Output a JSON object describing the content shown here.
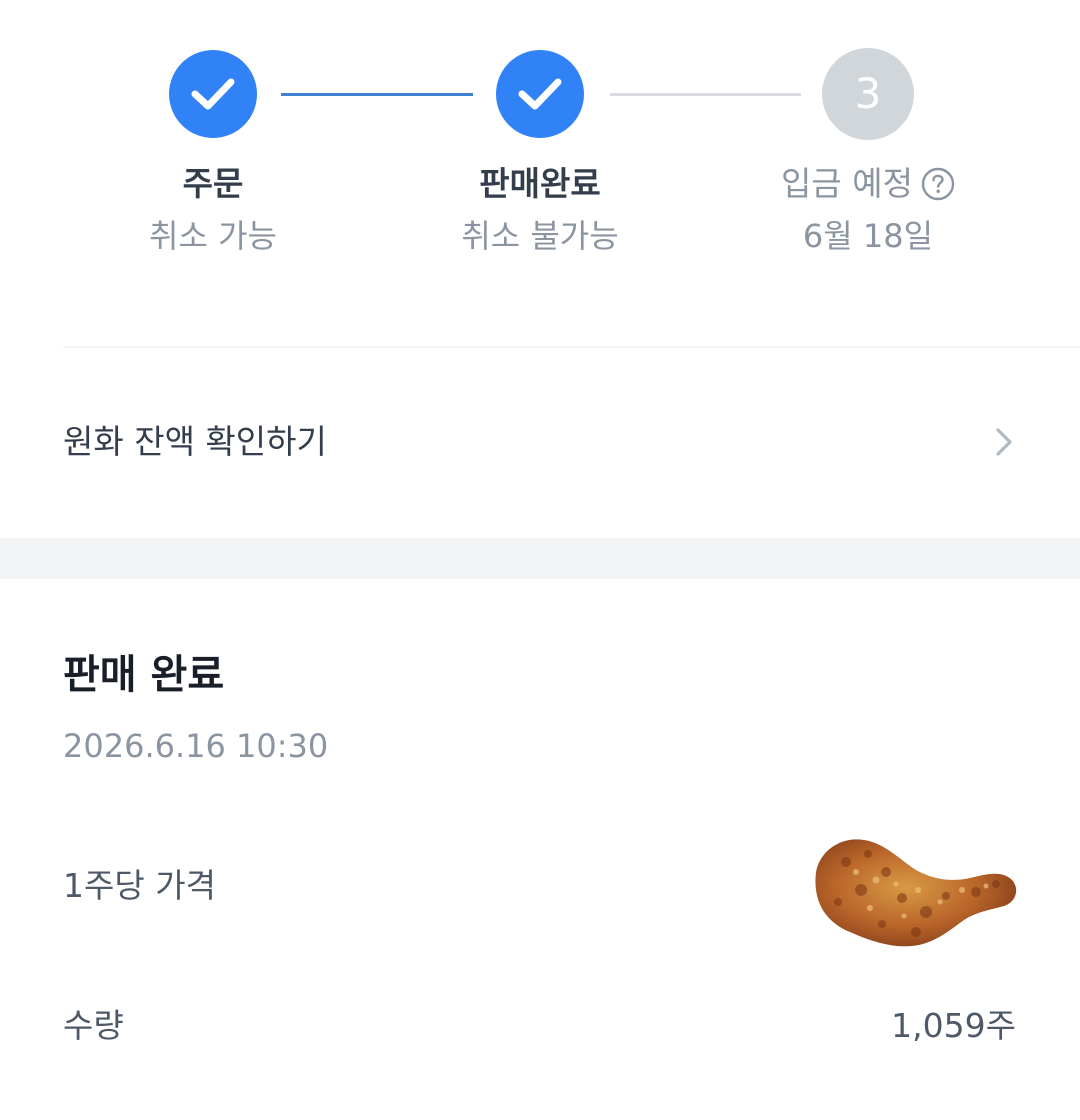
{
  "stepper": {
    "steps": [
      {
        "title": "주문",
        "subtitle": "취소 가능",
        "state": "done"
      },
      {
        "title": "판매완료",
        "subtitle": "취소 불가능",
        "state": "done"
      },
      {
        "number": "3",
        "title": "입금 예정",
        "subtitle": "6월 18일",
        "state": "pending"
      }
    ],
    "colors": {
      "done": "#3182f6",
      "pending": "#d1d6db",
      "line_done": "#3d7fd1",
      "line_pending": "#d9dde2"
    }
  },
  "balance_link": {
    "label": "원화 잔액 확인하기",
    "icon": "chevron-right-icon"
  },
  "detail": {
    "title": "판매 완료",
    "datetime": "2026.6.16 10:30",
    "rows": [
      {
        "label": "1주당 가격",
        "value_image": "fried-chicken-drumstick-image"
      },
      {
        "label": "수량",
        "value": "1,059주"
      }
    ]
  }
}
